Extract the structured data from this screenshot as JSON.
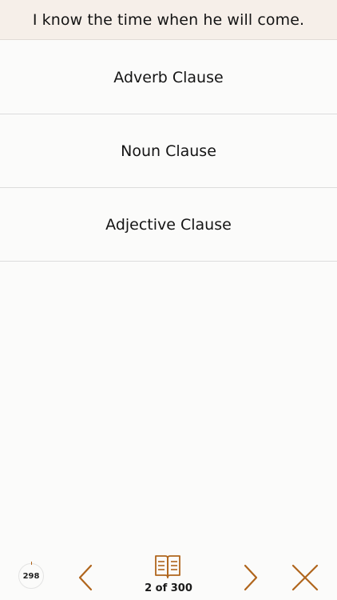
{
  "question": {
    "text": "I know the time when he will come."
  },
  "options": [
    {
      "label": "Adverb Clause"
    },
    {
      "label": "Noun Clause"
    },
    {
      "label": "Adjective Clause"
    }
  ],
  "toolbar": {
    "timer_value": "298",
    "page_counter": "2 of 300",
    "icons": {
      "timer": "timer-icon",
      "prev": "chevron-left-icon",
      "book": "book-icon",
      "next": "chevron-right-icon",
      "close": "close-icon"
    },
    "accent_color": "#b0651c"
  }
}
